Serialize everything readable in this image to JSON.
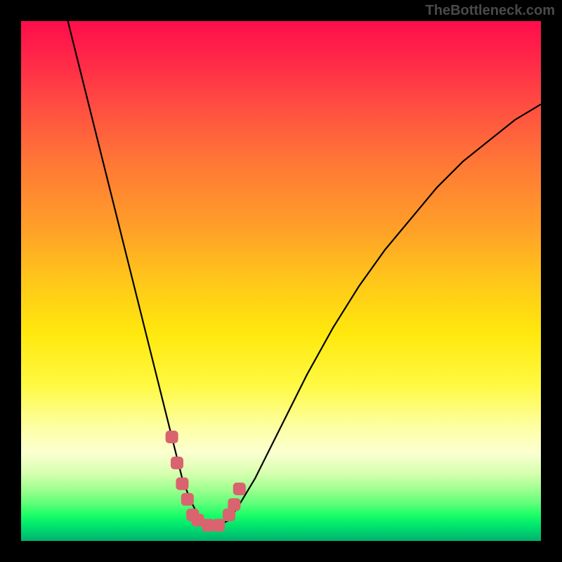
{
  "watermark": "TheBottleneck.com",
  "chart_data": {
    "type": "line",
    "title": "",
    "xlabel": "",
    "ylabel": "",
    "xlim": [
      0,
      100
    ],
    "ylim": [
      0,
      100
    ],
    "series": [
      {
        "name": "curve",
        "x": [
          9,
          12,
          15,
          18,
          21,
          24,
          27,
          29.5,
          31,
          32.5,
          34,
          36,
          38,
          40,
          42,
          45,
          50,
          55,
          60,
          65,
          70,
          75,
          80,
          85,
          90,
          95,
          100
        ],
        "values": [
          100,
          88,
          76,
          64,
          52,
          40,
          28,
          18,
          12,
          8,
          5,
          3,
          3,
          4,
          7,
          12,
          22,
          32,
          41,
          49,
          56,
          62,
          68,
          73,
          77,
          81,
          84
        ]
      }
    ],
    "highlight": {
      "color": "#d9636e",
      "x": [
        29,
        30,
        31,
        32,
        33,
        34,
        36,
        38,
        40,
        41,
        42
      ],
      "values": [
        20,
        15,
        11,
        8,
        5,
        4,
        3,
        3,
        5,
        7,
        10
      ]
    },
    "gradient_stops": [
      {
        "pos": 0,
        "color": "#ff0d4b"
      },
      {
        "pos": 0.5,
        "color": "#ffc71a"
      },
      {
        "pos": 0.78,
        "color": "#fdffa2"
      },
      {
        "pos": 1.0,
        "color": "#00b26d"
      }
    ]
  }
}
